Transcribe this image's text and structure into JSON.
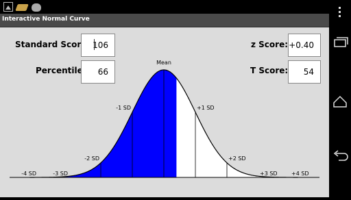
{
  "app": {
    "title": "Interactive Normal Curve"
  },
  "form": {
    "standard_score_label": "Standard Score:",
    "standard_score_value": "106",
    "percentile_label": "Percentile:",
    "percentile_value": "66",
    "z_score_label": "z Score:",
    "z_score_value": "+0.40",
    "t_score_label": "T Score:",
    "t_score_value": "54"
  },
  "chart_data": {
    "type": "area",
    "curve": "standard normal density",
    "shaded_up_to_z": 0.4,
    "x_range": [
      -4.25,
      4.25
    ],
    "sd_labels": [
      {
        "z": -4,
        "label": "-4 SD"
      },
      {
        "z": -3,
        "label": "-3 SD"
      },
      {
        "z": -2,
        "label": "-2 SD"
      },
      {
        "z": -1,
        "label": "-1 SD"
      },
      {
        "z": 0,
        "label": "Mean"
      },
      {
        "z": 1,
        "label": "+1 SD"
      },
      {
        "z": 2,
        "label": "+2 SD"
      },
      {
        "z": 3,
        "label": "+3 SD"
      },
      {
        "z": 4,
        "label": "+4 SD"
      }
    ],
    "fill_color": "#0000ff"
  },
  "icons": {
    "status": [
      "picture-icon",
      "book-icon",
      "android-cat-icon"
    ],
    "nav": [
      "overflow-menu-icon",
      "recent-apps-icon",
      "home-icon",
      "back-icon"
    ]
  }
}
